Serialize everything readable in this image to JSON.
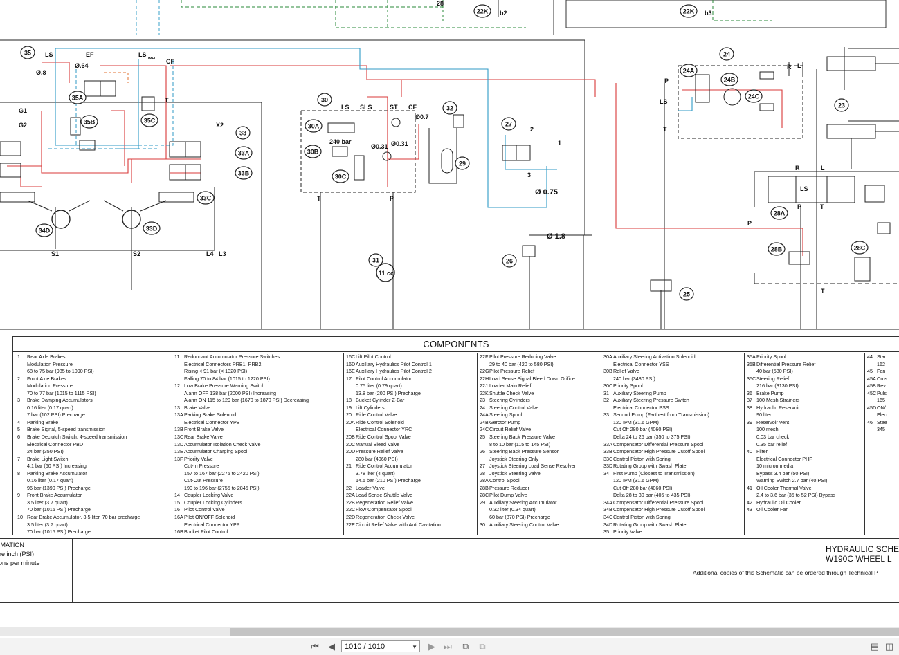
{
  "schematic": {
    "callouts": [
      "35",
      "24",
      "30",
      "32",
      "33",
      "33A",
      "33B",
      "33C",
      "33D",
      "34D",
      "35A",
      "35B",
      "35C",
      "30A",
      "30B",
      "30C",
      "27",
      "29",
      "31",
      "26",
      "25",
      "24A",
      "24B",
      "24C",
      "23",
      "28A",
      "28B",
      "28C",
      "22K",
      "22K"
    ],
    "port_labels": [
      "LS",
      "EF",
      "LS",
      "IMFL",
      "CF",
      "G1",
      "G2",
      "T",
      "X2",
      "S1",
      "S2",
      "L4",
      "L3",
      "LS",
      "SLS",
      "ST",
      "CF",
      "T",
      "P",
      "P",
      "LS",
      "T",
      "R",
      "L",
      "LS",
      "P",
      "T",
      "P",
      "T",
      "2",
      "1",
      "3",
      "b2",
      "b3",
      "L",
      "R",
      "28"
    ],
    "values": [
      "Ø.8",
      "Ø.64",
      "240 bar",
      "Ø0.31",
      "Ø0.31",
      "Ø0.7",
      "Ø 0.75",
      "Ø 1.8",
      "11 cc"
    ]
  },
  "components": {
    "title": "COMPONENTS",
    "columns": [
      [
        {
          "n": "1",
          "t": "Rear Axle Brakes"
        },
        {
          "n": "",
          "t": "Modulation Pressure"
        },
        {
          "n": "",
          "t": "68 to 75 bar (985 to 1090 PSI)"
        },
        {
          "n": "2",
          "t": "Front Axle Brakes"
        },
        {
          "n": "",
          "t": "Modulation Pressure"
        },
        {
          "n": "",
          "t": "70 to 77 bar (1015 to 1115 PSI)"
        },
        {
          "n": "3",
          "t": "Brake Damping Accumulators"
        },
        {
          "n": "",
          "t": "0.16 liter (0.17 quart)"
        },
        {
          "n": "",
          "t": "7 bar (102 PSI) Precharge"
        },
        {
          "n": "4",
          "t": "Parking Brake"
        },
        {
          "n": "5",
          "t": "Brake Signal, 5-speed transmission"
        },
        {
          "n": "6",
          "t": "Brake Declutch Switch, 4-speed transmission"
        },
        {
          "n": "",
          "t": "Electrical Connector PBD"
        },
        {
          "n": "",
          "t": "24 bar (350 PSI)"
        },
        {
          "n": "7",
          "t": "Brake Light Switch"
        },
        {
          "n": "",
          "t": "4.1 bar (60 PSI) Increasing"
        },
        {
          "n": "8",
          "t": "Parking Brake Accumulator"
        },
        {
          "n": "",
          "t": "0.16 liter (0.17 quart)"
        },
        {
          "n": "",
          "t": "96 bar (1390 PSI) Precharge"
        },
        {
          "n": "9",
          "t": "Front Brake Accumulator"
        },
        {
          "n": "",
          "t": "3.5 liter (3.7 quart)"
        },
        {
          "n": "",
          "t": "70 bar (1015 PSI) Precharge"
        },
        {
          "n": "10",
          "t": "Rear Brake Accumulator, 3.5 liter, 70 bar precharge"
        },
        {
          "n": "",
          "t": "3.5 liter (3.7 quart)"
        },
        {
          "n": "",
          "t": "70 bar (1015 PSI) Precharge"
        }
      ],
      [
        {
          "n": "11",
          "t": "Redundant Accumulator Pressure Switches"
        },
        {
          "n": "",
          "t": "Electrical Connectors PRB1, PRB2"
        },
        {
          "n": "",
          "t": "Rising < 91 bar (< 1320 PSI)"
        },
        {
          "n": "",
          "t": "Falling 70 to 84 bar (1015 to 1220 PSI)"
        },
        {
          "n": "12",
          "t": "Low Brake Pressure Warning Switch"
        },
        {
          "n": "",
          "t": "Alarm OFF 138 bar (2000 PSI) Increasing"
        },
        {
          "n": "",
          "t": "Alarm ON 115 to 129 bar (1670 to 1870 PSI) Decreasing"
        },
        {
          "n": "13",
          "t": "Brake Valve"
        },
        {
          "n": "13A",
          "t": "Parking Brake Solenoid"
        },
        {
          "n": "",
          "t": "Electrical Connector YPB"
        },
        {
          "n": "13B",
          "t": "Front Brake Valve"
        },
        {
          "n": "13C",
          "t": "Rear Brake Valve"
        },
        {
          "n": "13D",
          "t": "Accumulator Isolation Check Valve"
        },
        {
          "n": "13E",
          "t": "Accumulator Charging Spool"
        },
        {
          "n": "13F",
          "t": "Priority Valve"
        },
        {
          "n": "",
          "t": "Cut-In Pressure"
        },
        {
          "n": "",
          "t": "157 to 167 bar (2275 to 2420 PSI)"
        },
        {
          "n": "",
          "t": "Cut-Out Pressure"
        },
        {
          "n": "",
          "t": "190 to 196 bar (2755 to 2845 PSI)"
        },
        {
          "n": "14",
          "t": "Coupler Locking Valve"
        },
        {
          "n": "15",
          "t": "Coupler Locking Cylinders"
        },
        {
          "n": "16",
          "t": "Pilot Control Valve"
        },
        {
          "n": "16A",
          "t": "Pilot ON/OFF Solenoid"
        },
        {
          "n": "",
          "t": "Electrical Connector YPP"
        },
        {
          "n": "16B",
          "t": "Bucket Pilot Control"
        }
      ],
      [
        {
          "n": "16C",
          "t": "Lift Pilot Control"
        },
        {
          "n": "16D",
          "t": "Auxiliary Hydraulics Pilot Control 1"
        },
        {
          "n": "16E",
          "t": "Auxiliary Hydraulics Pilot Control 2"
        },
        {
          "n": "17",
          "t": "Pilot Control Accumulator"
        },
        {
          "n": "",
          "t": "0.75 liter (0.79 quart)"
        },
        {
          "n": "",
          "t": "13.8 bar (200 PSI) Precharge"
        },
        {
          "n": "18",
          "t": "Bucket Cylinder Z-Bar"
        },
        {
          "n": "19",
          "t": "Lift Cylinders"
        },
        {
          "n": "20",
          "t": "Ride Control Valve"
        },
        {
          "n": "20A",
          "t": "Ride Control Solenoid"
        },
        {
          "n": "",
          "t": "Electrical Connector YRC"
        },
        {
          "n": "20B",
          "t": "Ride Control Spool Valve"
        },
        {
          "n": "20C",
          "t": "Manual Bleed Valve"
        },
        {
          "n": "20D",
          "t": "Pressure Relief Valve"
        },
        {
          "n": "",
          "t": "280 bar (4060 PSI)"
        },
        {
          "n": "21",
          "t": "Ride Control Accumulator"
        },
        {
          "n": "",
          "t": "3.78 liter (4 quart)"
        },
        {
          "n": "",
          "t": "14.5 bar (210 PSI) Precharge"
        },
        {
          "n": "22",
          "t": "Loader Valve"
        },
        {
          "n": "22A",
          "t": "Load Sense Shuttle Valve"
        },
        {
          "n": "22B",
          "t": "Regeneration Relief Valve"
        },
        {
          "n": "22C",
          "t": "Flow Compensator Spool"
        },
        {
          "n": "22D",
          "t": "Regeneration Check Valve"
        },
        {
          "n": "22E",
          "t": "Circuit Relief Valve with Anti Cavitation"
        }
      ],
      [
        {
          "n": "22F",
          "t": "Pilot Pressure Reducing Valve"
        },
        {
          "n": "",
          "t": "29 to 40 bar (420 to 580 PSI)"
        },
        {
          "n": "22G",
          "t": "Pilot Pressure Relief"
        },
        {
          "n": "22H",
          "t": "Load Sense Signal Bleed Down Orifice"
        },
        {
          "n": "22J",
          "t": "Loader Main Relief"
        },
        {
          "n": "22K",
          "t": "Shuttle Check Valve"
        },
        {
          "n": "23",
          "t": "Steering Cylinders"
        },
        {
          "n": "24",
          "t": "Steering Control Valve"
        },
        {
          "n": "24A",
          "t": "Steering Spool"
        },
        {
          "n": "24B",
          "t": "Gerotor Pump"
        },
        {
          "n": "24C",
          "t": "Circuit Relief Valve"
        },
        {
          "n": "25",
          "t": "Steering Back Pressure Valve"
        },
        {
          "n": "",
          "t": "8 to 10 bar (115 to 145 PSI)"
        },
        {
          "n": "26",
          "t": "Steering Back Pressure Sensor"
        },
        {
          "n": "",
          "t": "Joystick Steering Only"
        },
        {
          "n": "27",
          "t": "Joystick Steering Load Sense Resolver"
        },
        {
          "n": "28",
          "t": "Joystick Steering Valve"
        },
        {
          "n": "28A",
          "t": "Control Spool"
        },
        {
          "n": "28B",
          "t": "Pressure Reducer"
        },
        {
          "n": "28C",
          "t": "Pilot Dump Valve"
        },
        {
          "n": "29",
          "t": "Auxiliary Steering Accumulator"
        },
        {
          "n": "",
          "t": "0.32 liter (0.34 quart)"
        },
        {
          "n": "",
          "t": "60 bar (870 PSI) Precharge"
        },
        {
          "n": "30",
          "t": "Auxiliary Steering Control Valve"
        }
      ],
      [
        {
          "n": "30A",
          "t": "Auxiliary Steering Activation Solenoid"
        },
        {
          "n": "",
          "t": "Electrical Connector YSS"
        },
        {
          "n": "30B",
          "t": "Relief Valve"
        },
        {
          "n": "",
          "t": "240 bar (3480 PSI)"
        },
        {
          "n": "30C",
          "t": "Priority Spool"
        },
        {
          "n": "31",
          "t": "Auxiliary Steering Pump"
        },
        {
          "n": "32",
          "t": "Auxiliary Steering Pressure Switch"
        },
        {
          "n": "",
          "t": "Electrical Connector PSS"
        },
        {
          "n": "33",
          "t": "Second Pump (Farthest from Transmission)"
        },
        {
          "n": "",
          "t": "120 IPM (31.6 GPM)"
        },
        {
          "n": "",
          "t": "Cut Off 280 bar (4060 PSI)"
        },
        {
          "n": "",
          "t": "Delta 24 to 26 bar (350 to 375 PSI)"
        },
        {
          "n": "33A",
          "t": "Compensator Differential Pressure Spool"
        },
        {
          "n": "33B",
          "t": "Compensator High Pressure Cutoff Spool"
        },
        {
          "n": "33C",
          "t": "Control Piston with Spring"
        },
        {
          "n": "33D",
          "t": "Rotating Group with Swash Plate"
        },
        {
          "n": "34",
          "t": "First Pump (Closest to Transmission)"
        },
        {
          "n": "",
          "t": "120 IPM (31.6 GPM)"
        },
        {
          "n": "",
          "t": "Cut Off 280 bar (4060 PSI)"
        },
        {
          "n": "",
          "t": "Delta 28 to 30 bar (405 to 435 PSI)"
        },
        {
          "n": "34A",
          "t": "Compensator Differential Pressure Spool"
        },
        {
          "n": "34B",
          "t": "Compensator High Pressure Cutoff Spool"
        },
        {
          "n": "34C",
          "t": "Control Piston with Spring"
        },
        {
          "n": "34D",
          "t": "Rotating Group with Swash Plate"
        },
        {
          "n": "35",
          "t": "Priority Valve"
        }
      ],
      [
        {
          "n": "35A",
          "t": "Priority Spool"
        },
        {
          "n": "35B",
          "t": "Differential Pressure Relief"
        },
        {
          "n": "",
          "t": "40 bar (580 PSI)"
        },
        {
          "n": "35C",
          "t": "Steering Relief"
        },
        {
          "n": "",
          "t": "216 bar (3130 PSI)"
        },
        {
          "n": "36",
          "t": "Brake Pump"
        },
        {
          "n": "37",
          "t": "100 Mesh Strainers"
        },
        {
          "n": "38",
          "t": "Hydraulic Reservoir"
        },
        {
          "n": "",
          "t": "90 liter"
        },
        {
          "n": "39",
          "t": "Reservoir Vent"
        },
        {
          "n": "",
          "t": "100 mesh"
        },
        {
          "n": "",
          "t": "0.03 bar check"
        },
        {
          "n": "",
          "t": "0.35 bar relief"
        },
        {
          "n": "40",
          "t": "Filter"
        },
        {
          "n": "",
          "t": "Electrical Connector PHF"
        },
        {
          "n": "",
          "t": "10 micron media"
        },
        {
          "n": "",
          "t": "Bypass 3.4 bar (50 PSI)"
        },
        {
          "n": "",
          "t": "Warning Switch 2.7 bar (40 PSI)"
        },
        {
          "n": "41",
          "t": "Oil Cooler Thermal Valve"
        },
        {
          "n": "",
          "t": "2.4 to 3.6 bar (35 to 52 PSI) Bypass"
        },
        {
          "n": "42",
          "t": "Hydraulic Oil Cooler"
        },
        {
          "n": "43",
          "t": "Oil Cooler Fan"
        }
      ],
      [
        {
          "n": "44",
          "t": "Star"
        },
        {
          "n": "",
          "t": "162"
        },
        {
          "n": "45",
          "t": "Fan"
        },
        {
          "n": "45A",
          "t": "Cros"
        },
        {
          "n": "45B",
          "t": "Rev"
        },
        {
          "n": "45C",
          "t": "Puls"
        },
        {
          "n": "",
          "t": "165"
        },
        {
          "n": "45D",
          "t": "ON/"
        },
        {
          "n": "",
          "t": "Elec"
        },
        {
          "n": "46",
          "t": "Stee"
        },
        {
          "n": "",
          "t": "345"
        }
      ]
    ]
  },
  "info": {
    "left_lines": [
      "RMATION",
      "",
      "are inch (PSI)",
      "llons per minute"
    ],
    "title_line1": "HYDRAULIC SCHE",
    "title_line2": "W190C  WHEEL L",
    "note": "Additional copies of this Schematic can be ordered through Technical P"
  },
  "toolbar": {
    "page_value": "1010 / 1010",
    "icons": [
      "first-page-icon",
      "prev-page-icon",
      "next-page-icon",
      "last-page-icon",
      "copy-icon",
      "paste-icon",
      "single-page-icon",
      "two-page-icon"
    ]
  }
}
